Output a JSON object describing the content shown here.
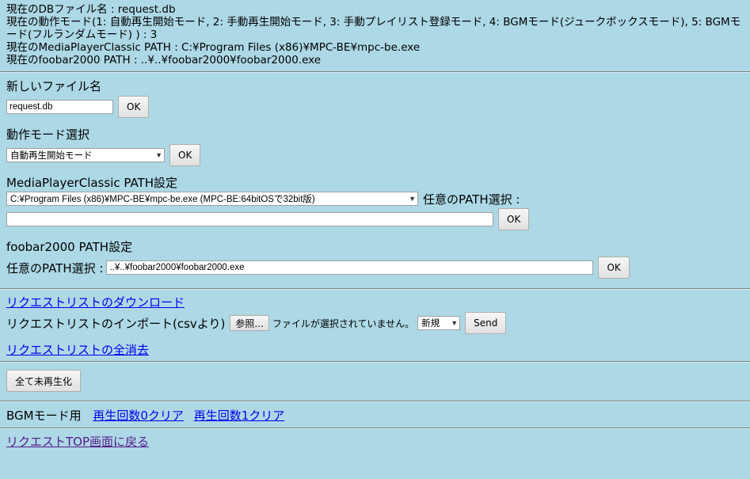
{
  "info": {
    "db_line": "現在のDBファイル名 : request.db",
    "mode_line": "現在の動作モード(1: 自動再生開始モード, 2: 手動再生開始モード, 3: 手動プレイリスト登録モード, 4: BGMモード(ジュークボックスモード), 5: BGMモード(フルランダムモード) ) : 3",
    "mpc_line": "現在のMediaPlayerClassic PATH : C:¥Program Files (x86)¥MPC-BE¥mpc-be.exe",
    "foobar_line": "現在のfoobar2000 PATH : ..¥..¥foobar2000¥foobar2000.exe"
  },
  "filename": {
    "label": "新しいファイル名",
    "value": "request.db",
    "ok": "OK"
  },
  "mode": {
    "label": "動作モード選択",
    "selected": "自動再生開始モード",
    "ok": "OK"
  },
  "mpc": {
    "label": "MediaPlayerClassic PATH設定",
    "selected": "C:¥Program Files (x86)¥MPC-BE¥mpc-be.exe (MPC-BE:64bitOSで32bit版)",
    "custom_label": "任意のPATH選択 :",
    "custom_value": "",
    "ok": "OK"
  },
  "foobar": {
    "label": "foobar2000 PATH設定",
    "custom_label": "任意のPATH選択 :",
    "value": "..¥..¥foobar2000¥foobar2000.exe",
    "ok": "OK"
  },
  "requestlist": {
    "download_link": "リクエストリストのダウンロード",
    "import_label": "リクエストリストのインポート(csvより)",
    "browse": "参照...",
    "no_file": "ファイルが選択されていません。",
    "import_mode": "新規",
    "send": "Send",
    "clear_all_link": "リクエストリストの全消去"
  },
  "unplayed_button": "全て未再生化",
  "bgm": {
    "label": "BGMモード用",
    "clear0": "再生回数0クリア",
    "clear1": "再生回数1クリア"
  },
  "back_link": "リクエストTOP画面に戻る"
}
